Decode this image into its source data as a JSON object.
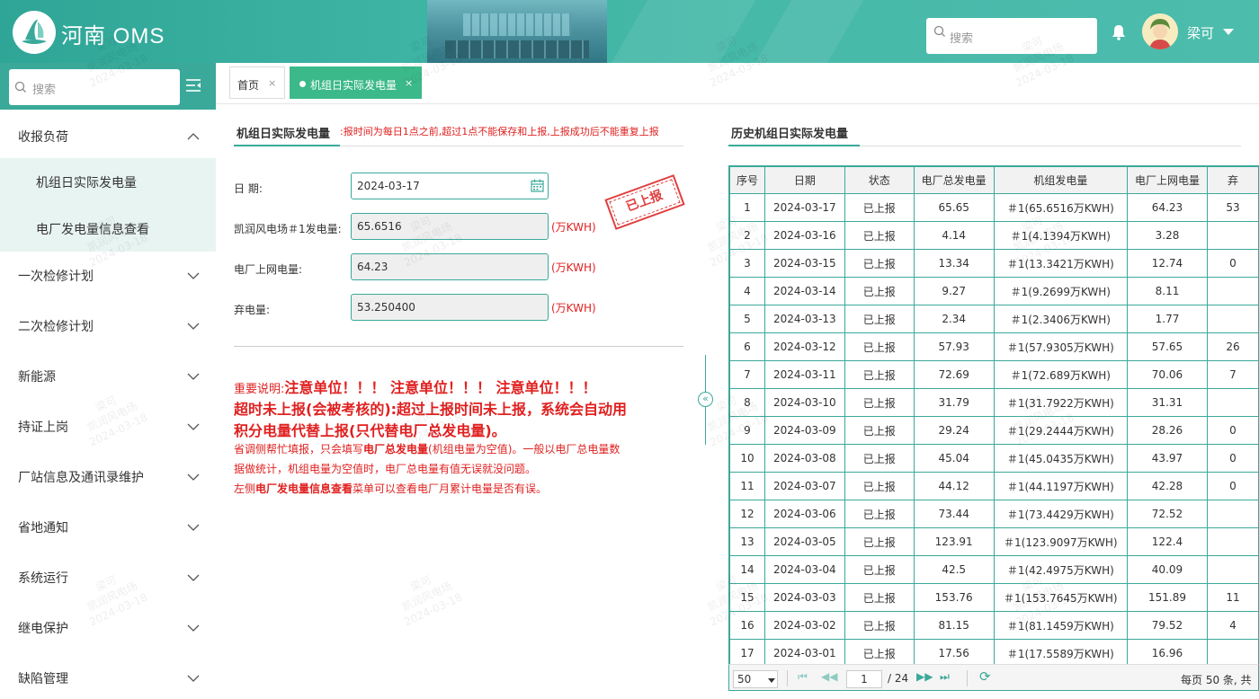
{
  "header": {
    "app_title": "河南 OMS",
    "search_placeholder": "搜索",
    "user_name": "梁可"
  },
  "sidebar": {
    "search_placeholder": "搜索",
    "menu": [
      {
        "label": "收报负荷",
        "expanded": true,
        "children": [
          "机组日实际发电量",
          "电厂发电量信息查看"
        ]
      },
      {
        "label": "一次检修计划"
      },
      {
        "label": "二次检修计划"
      },
      {
        "label": "新能源"
      },
      {
        "label": "持证上岗"
      },
      {
        "label": "厂站信息及通讯录维护"
      },
      {
        "label": "省地通知"
      },
      {
        "label": "系统运行"
      },
      {
        "label": "继电保护"
      },
      {
        "label": "缺陷管理"
      }
    ]
  },
  "tabs": [
    {
      "label": "首页",
      "close": "×",
      "active": false
    },
    {
      "label": "机组日实际发电量",
      "close": "×",
      "active": true
    }
  ],
  "form": {
    "title": "机组日实际发电量",
    "notice": ":报时间为每日1点之前,超过1点不能保存和上报,上报成功后不能重复上报",
    "date_label": "日 期:",
    "date_value": "2024-03-17",
    "unit_gen_label": "凯润风电场＃1发电量:",
    "unit_gen_value": "65.6516",
    "grid_label": "电厂上网电量:",
    "grid_value": "64.23",
    "curtail_label": "弃电量:",
    "curtail_value": "53.250400",
    "unit": "(万KWH)",
    "stamp": "已上报"
  },
  "notes": {
    "prefix": "重要说明:",
    "l1_bold": "注意单位！！！ 注意单位！！！ 注意单位！！！",
    "l2": "超时未上报(会被考核的):超过上报时间未上报，系统会自动用",
    "l3": "积分电量代替上报(只代替电厂总发电量)。",
    "l4a": "省调侧帮忙填报，只会填写",
    "l4b": "电厂总发电量",
    "l4c": "(机组电量为空值)。一般以电厂总电量数",
    "l5": "据做统计，机组电量为空值时，电厂总电量有值无误就没问题。",
    "l6a": "左侧",
    "l6b": "电厂发电量信息查看",
    "l6c": "菜单可以查看电厂月累计电量是否有误。"
  },
  "history": {
    "title": "历史机组日实际发电量",
    "columns": [
      "序号",
      "日期",
      "状态",
      "电厂总发电量",
      "机组发电量",
      "电厂上网电量",
      "弃"
    ],
    "rows": [
      [
        "1",
        "2024-03-17",
        "已上报",
        "65.65",
        "＃1(65.6516万KWH)",
        "64.23",
        "53"
      ],
      [
        "2",
        "2024-03-16",
        "已上报",
        "4.14",
        "＃1(4.1394万KWH)",
        "3.28",
        ""
      ],
      [
        "3",
        "2024-03-15",
        "已上报",
        "13.34",
        "＃1(13.3421万KWH)",
        "12.74",
        "0"
      ],
      [
        "4",
        "2024-03-14",
        "已上报",
        "9.27",
        "＃1(9.2699万KWH)",
        "8.11",
        ""
      ],
      [
        "5",
        "2024-03-13",
        "已上报",
        "2.34",
        "＃1(2.3406万KWH)",
        "1.77",
        ""
      ],
      [
        "6",
        "2024-03-12",
        "已上报",
        "57.93",
        "＃1(57.9305万KWH)",
        "57.65",
        "26"
      ],
      [
        "7",
        "2024-03-11",
        "已上报",
        "72.69",
        "＃1(72.689万KWH)",
        "70.06",
        "7"
      ],
      [
        "8",
        "2024-03-10",
        "已上报",
        "31.79",
        "＃1(31.7922万KWH)",
        "31.31",
        ""
      ],
      [
        "9",
        "2024-03-09",
        "已上报",
        "29.24",
        "＃1(29.2444万KWH)",
        "28.26",
        "0"
      ],
      [
        "10",
        "2024-03-08",
        "已上报",
        "45.04",
        "＃1(45.0435万KWH)",
        "43.97",
        "0"
      ],
      [
        "11",
        "2024-03-07",
        "已上报",
        "44.12",
        "＃1(44.1197万KWH)",
        "42.28",
        "0"
      ],
      [
        "12",
        "2024-03-06",
        "已上报",
        "73.44",
        "＃1(73.4429万KWH)",
        "72.52",
        ""
      ],
      [
        "13",
        "2024-03-05",
        "已上报",
        "123.91",
        "＃1(123.9097万KWH)",
        "122.4",
        ""
      ],
      [
        "14",
        "2024-03-04",
        "已上报",
        "42.5",
        "＃1(42.4975万KWH)",
        "40.09",
        ""
      ],
      [
        "15",
        "2024-03-03",
        "已上报",
        "153.76",
        "＃1(153.7645万KWH)",
        "151.89",
        "11"
      ],
      [
        "16",
        "2024-03-02",
        "已上报",
        "81.15",
        "＃1(81.1459万KWH)",
        "79.52",
        "4"
      ],
      [
        "17",
        "2024-03-01",
        "已上报",
        "17.56",
        "＃1(17.5589万KWH)",
        "16.96",
        ""
      ]
    ]
  },
  "pager": {
    "page_size": "50",
    "current_page": "1",
    "total_pages": "/ 24",
    "summary": "每页 50 条, 共"
  },
  "watermark": {
    "name": "梁可",
    "org": "凯润风电场",
    "date": "2024-03-18"
  },
  "colors": {
    "primary": "#3aa99a",
    "active_tab": "#3cb98a",
    "warning": "#e02020"
  }
}
